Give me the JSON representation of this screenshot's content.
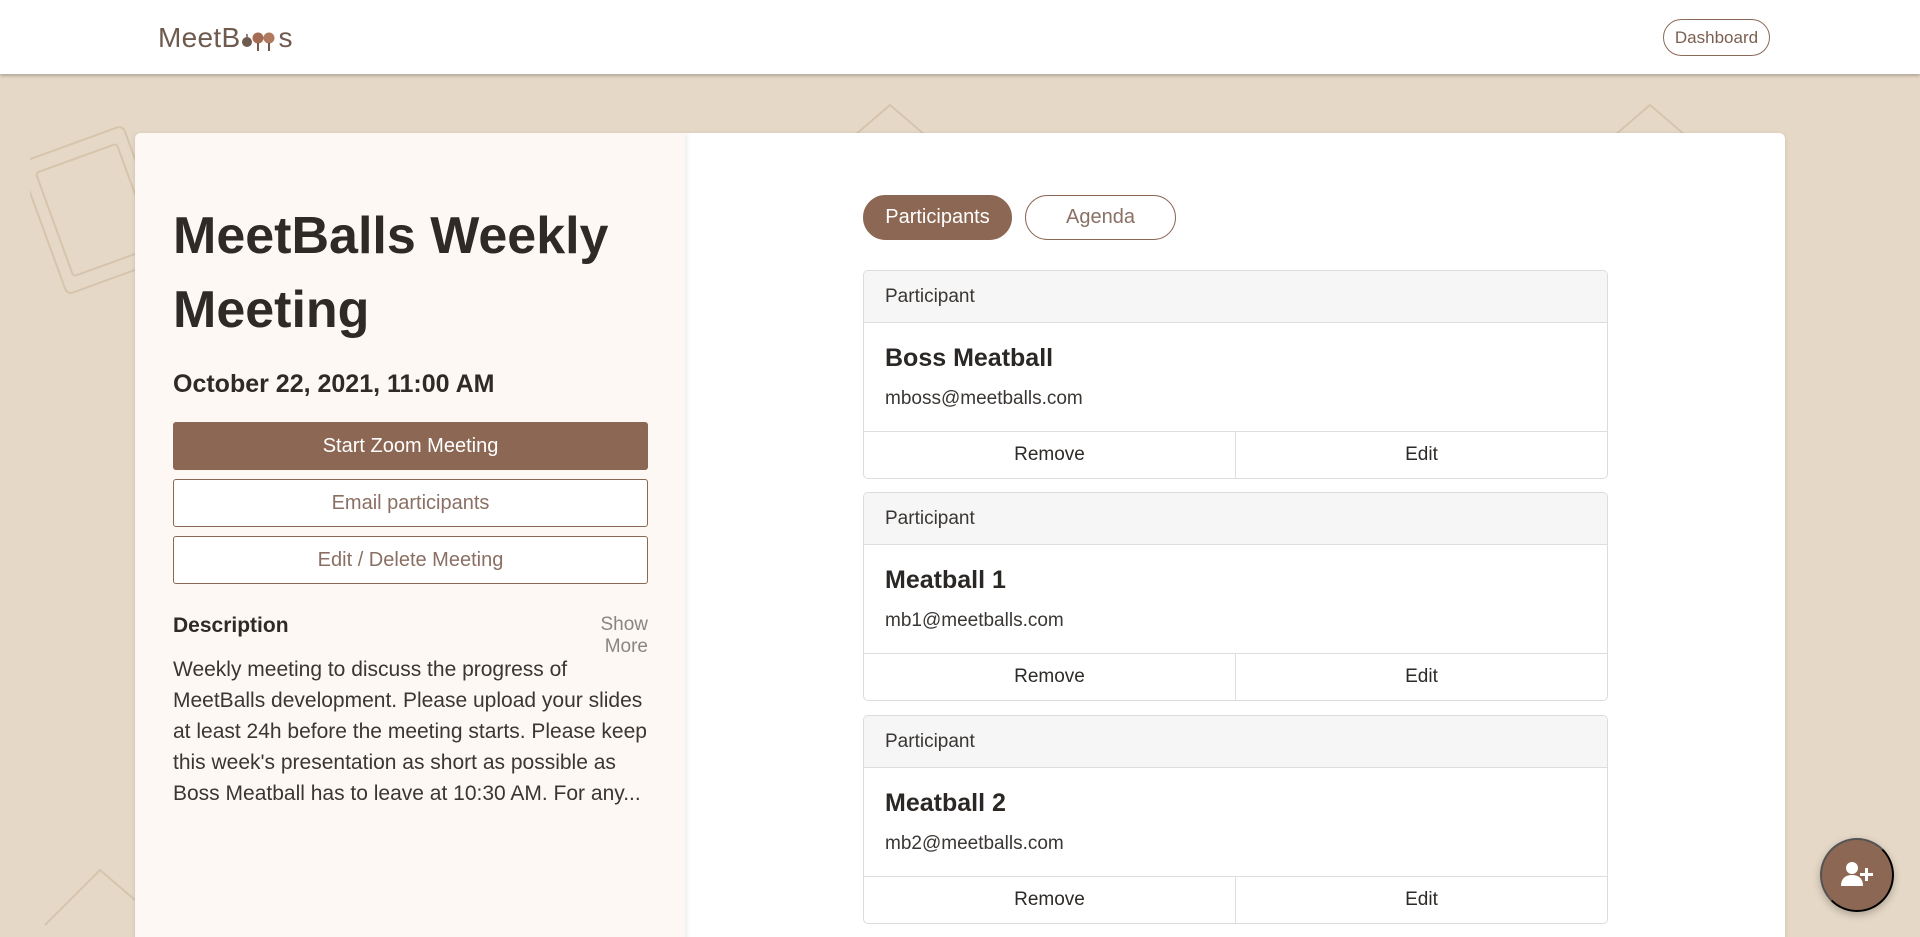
{
  "header": {
    "logo_text_left": "MeetB",
    "logo_text_right": "s",
    "dashboard_label": "Dashboard"
  },
  "meeting": {
    "title": "MeetBalls Weekly Meeting",
    "datetime": "October 22, 2021, 11:00 AM",
    "start_zoom_label": "Start Zoom Meeting",
    "email_participants_label": "Email participants",
    "edit_delete_label": "Edit / Delete Meeting",
    "description_label": "Description",
    "show_more_label": "Show More",
    "description_text": "Weekly meeting to discuss the progress of MeetBalls development. Please upload your slides at least 24h before the meeting starts. Please keep this week's presentation as short as possible as Boss Meatball has to leave at 10:30 AM. For any..."
  },
  "tabs": [
    {
      "label": "Participants",
      "active": true
    },
    {
      "label": "Agenda",
      "active": false
    }
  ],
  "participants": [
    {
      "header": "Participant",
      "name": "Boss Meatball",
      "email": "mboss@meetballs.com",
      "remove_label": "Remove",
      "edit_label": "Edit"
    },
    {
      "header": "Participant",
      "name": "Meatball 1",
      "email": "mb1@meetballs.com",
      "remove_label": "Remove",
      "edit_label": "Edit"
    },
    {
      "header": "Participant",
      "name": "Meatball 2",
      "email": "mb2@meetballs.com",
      "remove_label": "Remove",
      "edit_label": "Edit"
    }
  ],
  "fab": {
    "icon": "add-user-icon"
  },
  "colors": {
    "brand": "#8c6753",
    "background": "#e6d8c6",
    "left_pane": "#fdf8f4"
  }
}
